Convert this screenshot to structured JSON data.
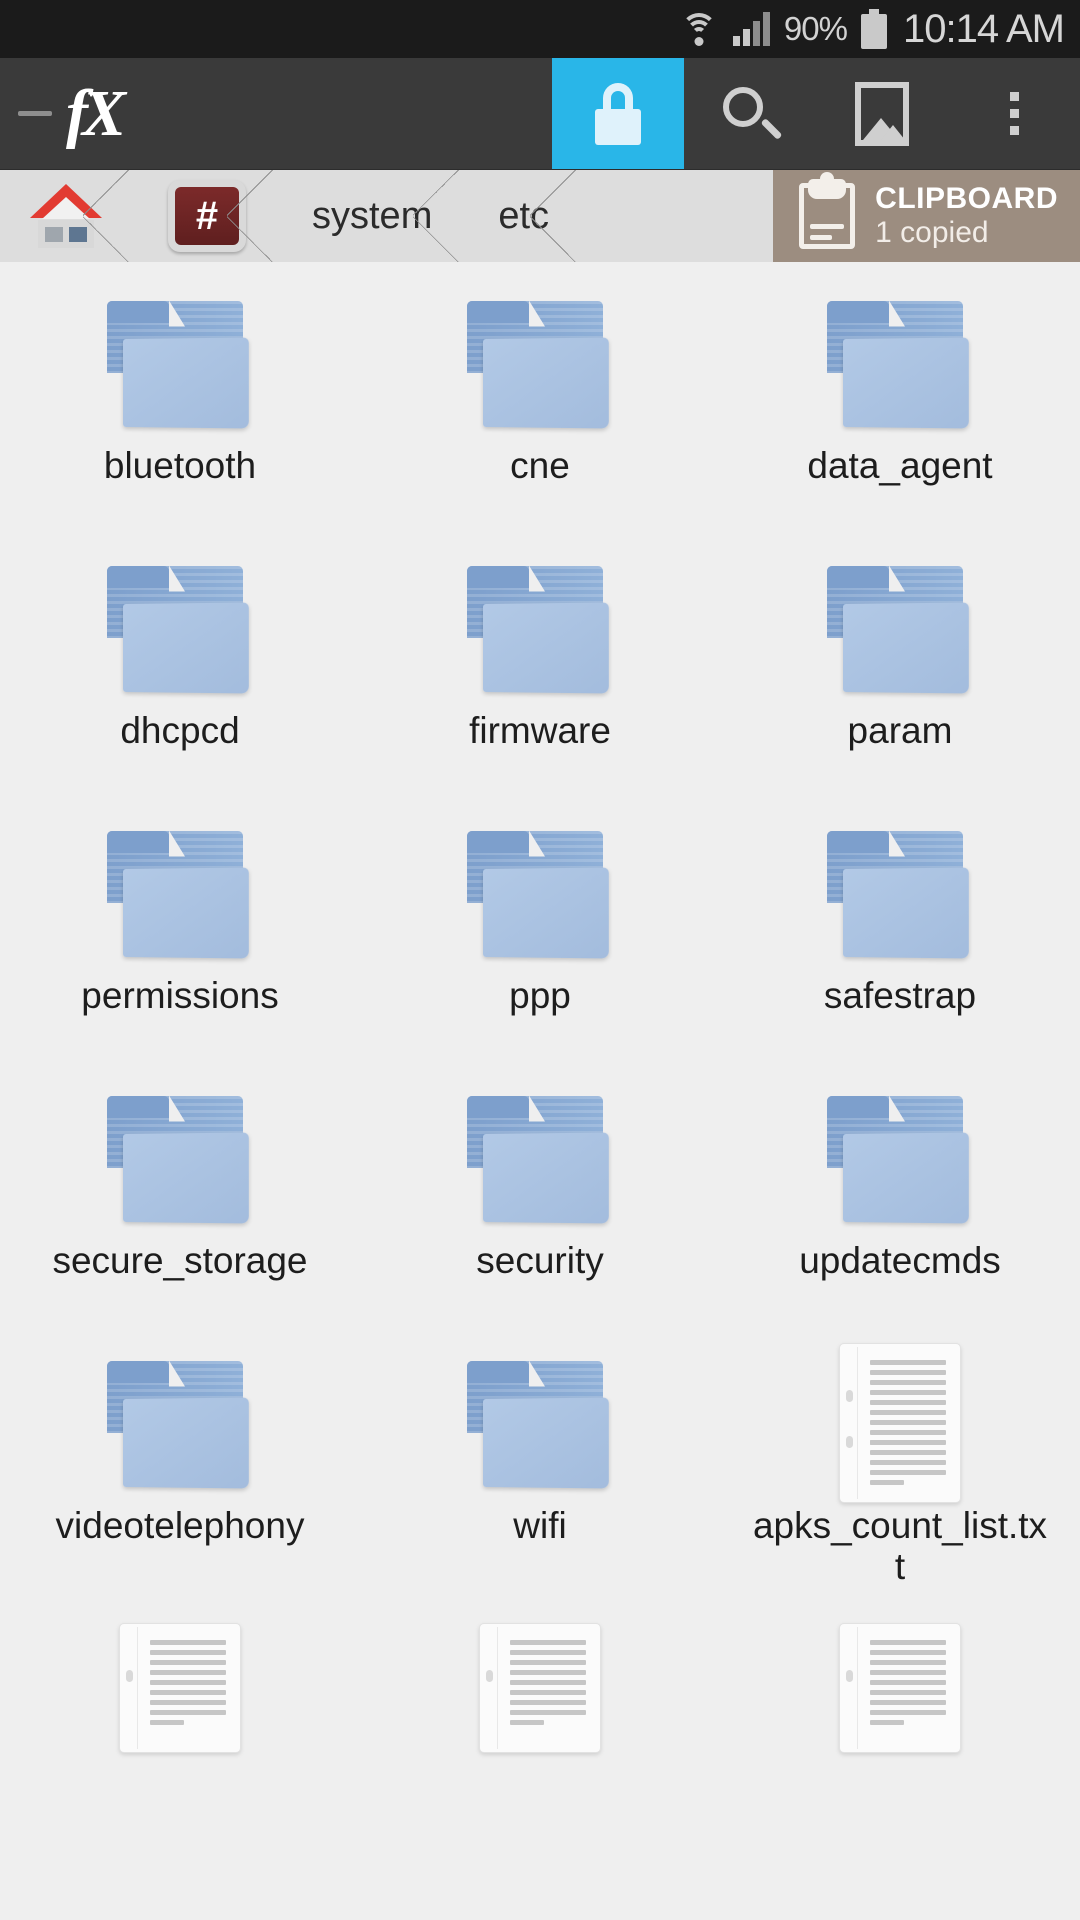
{
  "status_bar": {
    "wifi_icon": "wifi-icon",
    "signal_icon": "cellular-signal-icon",
    "battery_percent": "90%",
    "battery_icon": "battery-icon",
    "time": "10:14 AM"
  },
  "toolbar": {
    "up_indicator": "up-navigation-dash",
    "app_logo": "fX",
    "buttons": [
      {
        "name": "lock-button",
        "icon": "lock-icon",
        "active": true
      },
      {
        "name": "search-button",
        "icon": "search-icon",
        "active": false
      },
      {
        "name": "gallery-button",
        "icon": "image-icon",
        "active": false
      },
      {
        "name": "overflow-button",
        "icon": "more-vertical-icon",
        "active": false
      }
    ]
  },
  "breadcrumb": {
    "items": [
      {
        "type": "icon",
        "icon": "home-icon",
        "label": ""
      },
      {
        "type": "icon",
        "icon": "root-hash-icon",
        "label": "#"
      },
      {
        "type": "text",
        "icon": "",
        "label": "system"
      },
      {
        "type": "text",
        "icon": "",
        "label": "etc"
      }
    ]
  },
  "clipboard": {
    "icon": "clipboard-icon",
    "title": "CLIPBOARD",
    "subtitle": "1 copied"
  },
  "file_grid": {
    "items": [
      {
        "name": "bluetooth",
        "type": "folder"
      },
      {
        "name": "cne",
        "type": "folder"
      },
      {
        "name": "data_agent",
        "type": "folder"
      },
      {
        "name": "dhcpcd",
        "type": "folder"
      },
      {
        "name": "firmware",
        "type": "folder"
      },
      {
        "name": "param",
        "type": "folder"
      },
      {
        "name": "permissions",
        "type": "folder"
      },
      {
        "name": "ppp",
        "type": "folder"
      },
      {
        "name": "safestrap",
        "type": "folder"
      },
      {
        "name": "secure_storage",
        "type": "folder"
      },
      {
        "name": "security",
        "type": "folder"
      },
      {
        "name": "updatecmds",
        "type": "folder"
      },
      {
        "name": "videotelephony",
        "type": "folder"
      },
      {
        "name": "wifi",
        "type": "folder"
      },
      {
        "name": "apks_count_list.txt",
        "type": "document"
      },
      {
        "name": "",
        "type": "document-cut"
      },
      {
        "name": "",
        "type": "document-cut"
      },
      {
        "name": "",
        "type": "document-cut"
      }
    ]
  },
  "colors": {
    "accent_blue": "#29b6e8",
    "status_bar_bg": "#1b1b1b",
    "toolbar_bg": "#3a3a3a",
    "breadcrumb_bg": "#dddddd",
    "clipboard_bg": "#9c8d80",
    "grid_bg": "#efefef",
    "folder_blue": "#a3bcdd",
    "home_roof_red": "#e23b32",
    "root_icon_red": "#7c2a2a"
  }
}
